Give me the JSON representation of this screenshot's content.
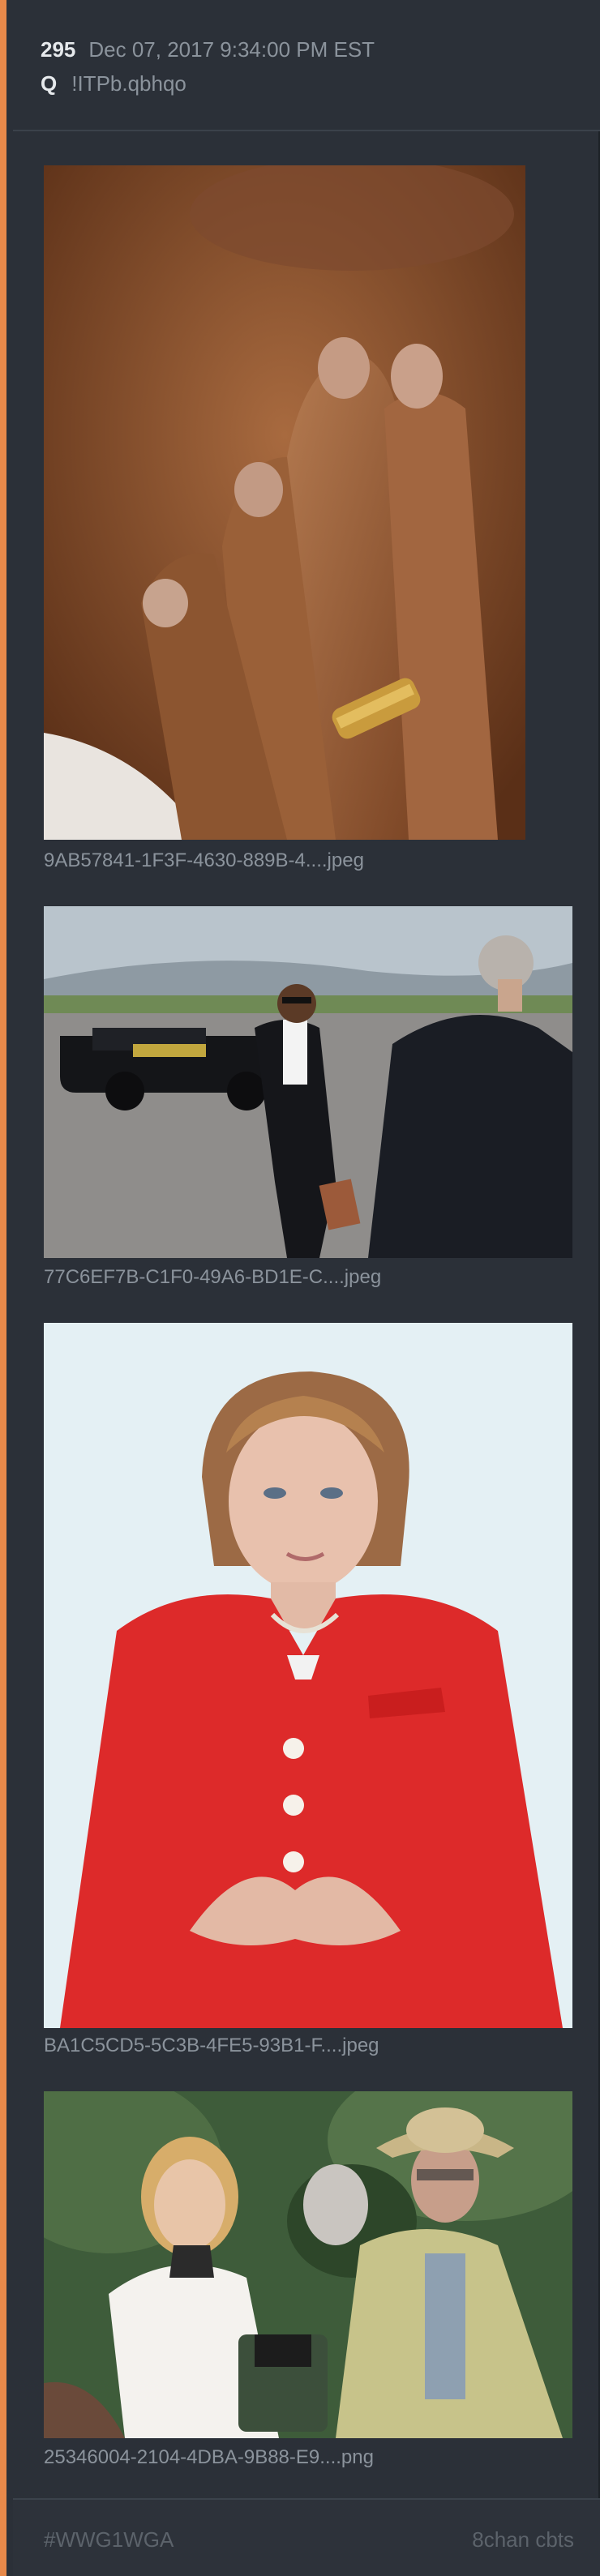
{
  "post": {
    "number": "295",
    "timestamp": "Dec 07, 2017 9:34:00 PM EST",
    "author_label": "Q",
    "tripcode": "!ITPb.qbhqo"
  },
  "attachments": [
    {
      "filename": "9AB57841-1F3F-4630-889B-4....jpeg"
    },
    {
      "filename": "77C6EF7B-C1F0-49A6-BD1E-C....jpeg"
    },
    {
      "filename": "BA1C5CD5-5C3B-4FE5-93B1-F....jpeg"
    },
    {
      "filename": "25346004-2104-4DBA-9B88-E9....png"
    }
  ],
  "footer": {
    "hashtag": "#WWG1WGA",
    "source": "8chan cbts"
  },
  "colors": {
    "accent_border": "#e8894a",
    "card_bg": "#2b3038",
    "page_bg": "#242a31"
  }
}
